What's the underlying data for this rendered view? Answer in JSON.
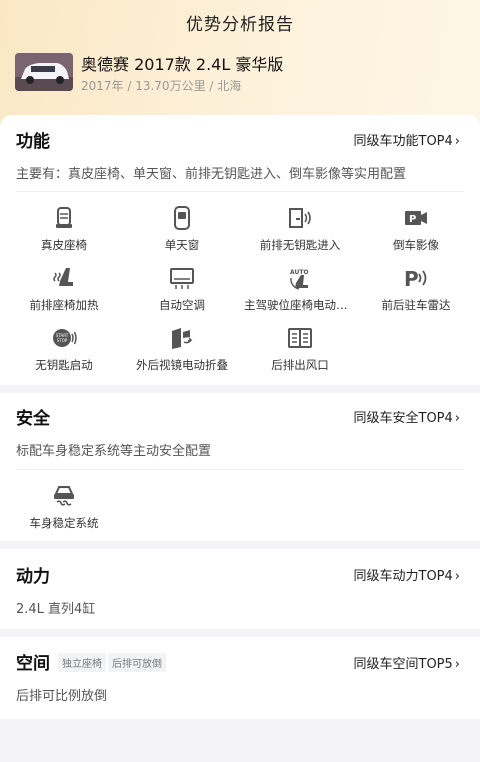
{
  "header": {
    "title": "优势分析报告",
    "car_name": "奥德赛 2017款 2.4L 豪华版",
    "car_meta": "2017年 / 13.70万公里 / 北海"
  },
  "sections": {
    "function": {
      "title": "功能",
      "link": "同级车功能TOP4",
      "desc": "主要有：真皮座椅、单天窗、前排无钥匙进入、倒车影像等实用配置",
      "features": [
        {
          "label": "真皮座椅",
          "icon": "leather-seat-icon"
        },
        {
          "label": "单天窗",
          "icon": "sunroof-icon"
        },
        {
          "label": "前排无钥匙进入",
          "icon": "keyless-entry-icon"
        },
        {
          "label": "倒车影像",
          "icon": "reverse-camera-icon"
        },
        {
          "label": "前排座椅加热",
          "icon": "seat-heating-icon"
        },
        {
          "label": "自动空调",
          "icon": "auto-ac-icon"
        },
        {
          "label": "主驾驶位座椅电动调节",
          "icon": "power-seat-icon"
        },
        {
          "label": "前后驻车雷达",
          "icon": "parking-radar-icon"
        },
        {
          "label": "无钥匙启动",
          "icon": "start-stop-icon"
        },
        {
          "label": "外后视镜电动折叠",
          "icon": "mirror-fold-icon"
        },
        {
          "label": "后排出风口",
          "icon": "rear-vent-icon"
        }
      ]
    },
    "safety": {
      "title": "安全",
      "link": "同级车安全TOP4",
      "desc": "标配车身稳定系统等主动安全配置",
      "features": [
        {
          "label": "车身稳定系统",
          "icon": "stability-control-icon"
        }
      ]
    },
    "power": {
      "title": "动力",
      "link": "同级车动力TOP4",
      "desc": "2.4L 直列4缸"
    },
    "space": {
      "title": "空间",
      "tags": [
        "独立座椅",
        "后排可放倒"
      ],
      "link": "同级车空间TOP5",
      "desc": "后排可比例放倒"
    }
  },
  "colors": {
    "icon": "#555555",
    "hero_start": "#fbe7c4",
    "hero_end": "#fdf6e8"
  }
}
